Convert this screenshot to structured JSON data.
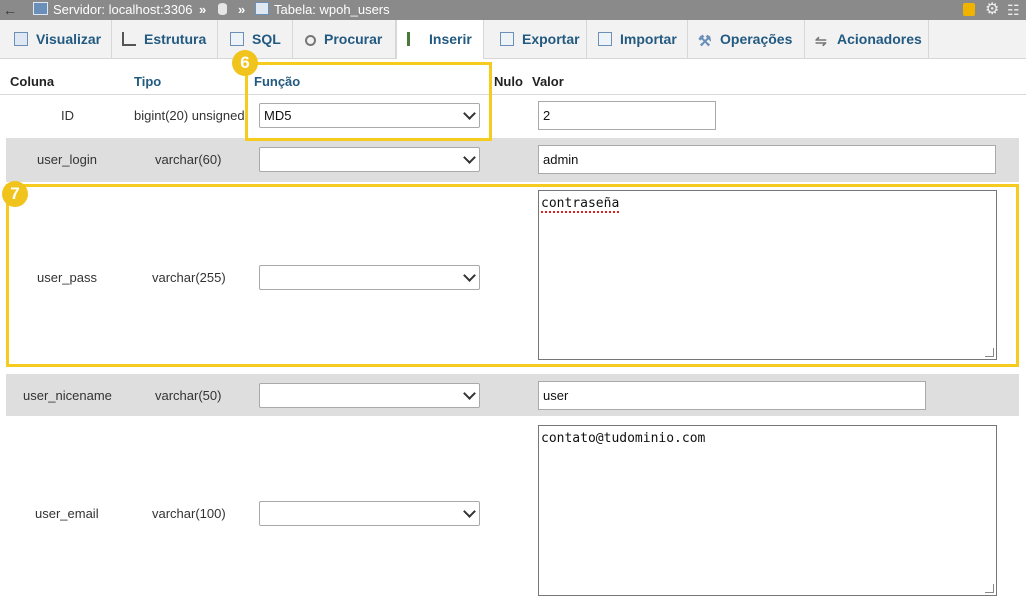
{
  "breadcrumb": {
    "server": "Servidor: localhost:3306",
    "separator": "»",
    "table": "Tabela: wpoh_users"
  },
  "tabs": [
    {
      "label": "Visualizar",
      "icon": "browse-icon"
    },
    {
      "label": "Estrutura",
      "icon": "structure-icon"
    },
    {
      "label": "SQL",
      "icon": "sql-icon"
    },
    {
      "label": "Procurar",
      "icon": "search-icon"
    },
    {
      "label": "Inserir",
      "icon": "insert-icon",
      "active": true
    },
    {
      "label": "Exportar",
      "icon": "export-icon"
    },
    {
      "label": "Importar",
      "icon": "import-icon"
    },
    {
      "label": "Operações",
      "icon": "wrench-icon"
    },
    {
      "label": "Acionadores",
      "icon": "triggers-icon"
    }
  ],
  "columns": {
    "coluna": "Coluna",
    "tipo": "Tipo",
    "funcao": "Função",
    "nulo": "Nulo",
    "valor": "Valor"
  },
  "rows": [
    {
      "name": "ID",
      "type": "bigint(20) unsigned",
      "function": "MD5",
      "value": "2"
    },
    {
      "name": "user_login",
      "type": "varchar(60)",
      "function": "",
      "value": "admin"
    },
    {
      "name": "user_pass",
      "type": "varchar(255)",
      "function": "",
      "value": "contraseña"
    },
    {
      "name": "user_nicename",
      "type": "varchar(50)",
      "function": "",
      "value": "user"
    },
    {
      "name": "user_email",
      "type": "varchar(100)",
      "function": "",
      "value": "contato@tudominio.com"
    }
  ],
  "annotations": {
    "badge6": "6",
    "badge7": "7"
  },
  "colors": {
    "highlight": "#f5cc1e",
    "badge": "#f1c31d",
    "link": "#235a81"
  }
}
